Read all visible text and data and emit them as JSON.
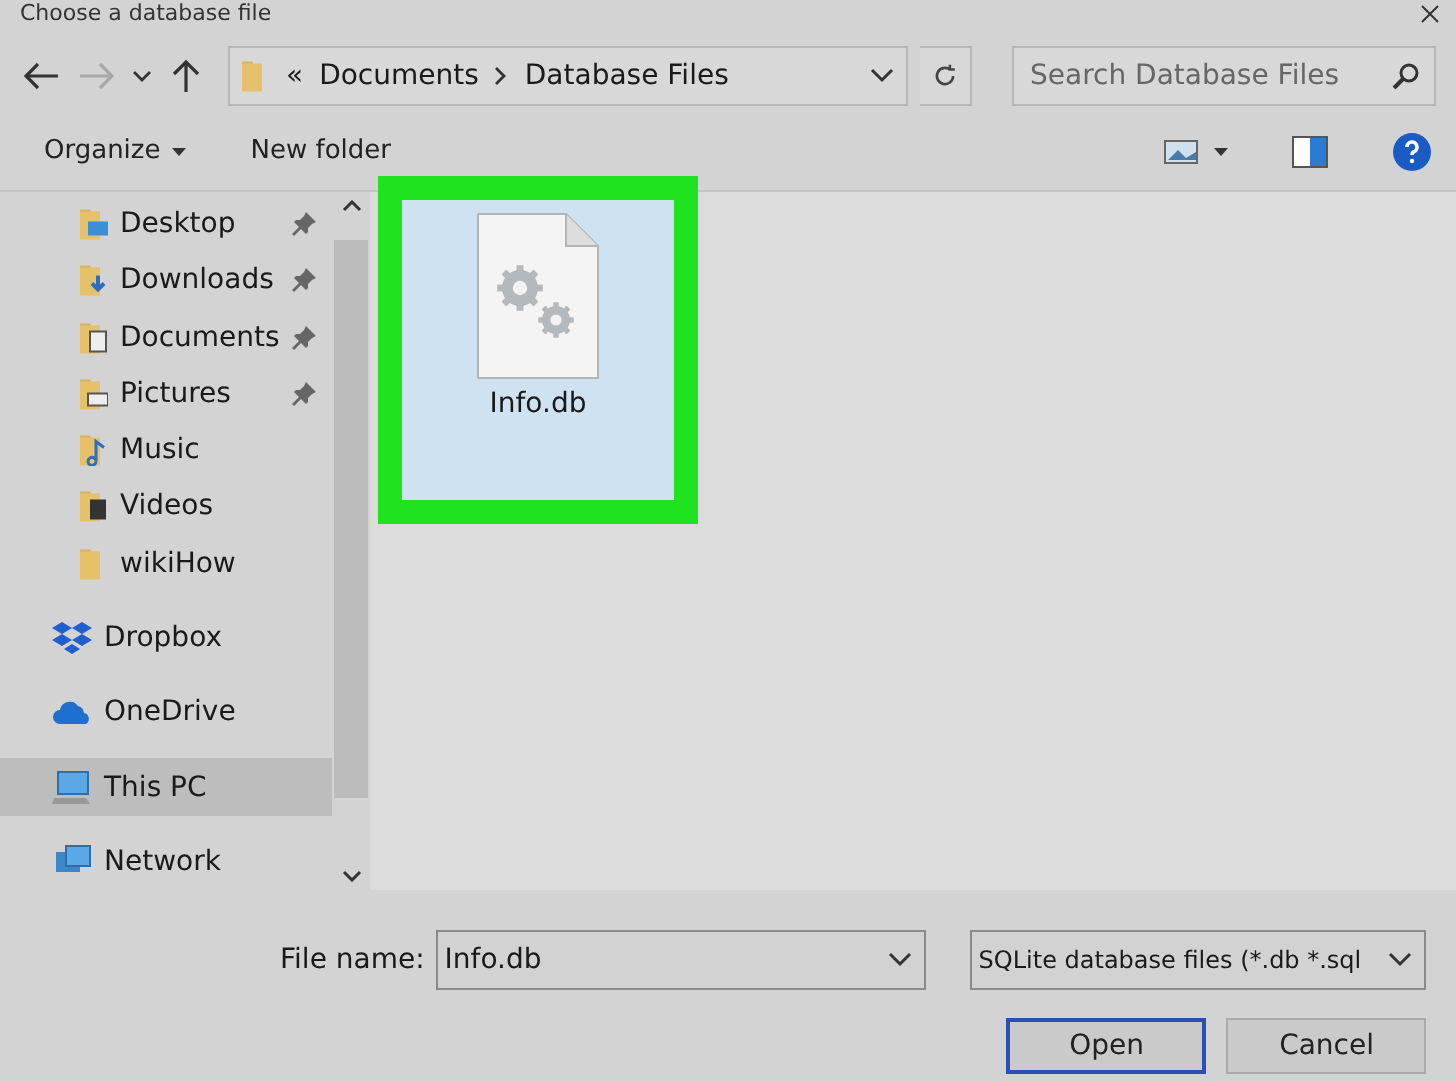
{
  "window": {
    "title": "Choose a database file"
  },
  "address_bar": {
    "overflow": "«",
    "path": [
      "Documents",
      "Database Files"
    ]
  },
  "search": {
    "placeholder": "Search Database Files"
  },
  "toolbar": {
    "organize": "Organize",
    "new_folder": "New folder"
  },
  "sidebar": {
    "items": [
      {
        "label": "Desktop",
        "kind": "desktop",
        "pinned": true,
        "selected": false
      },
      {
        "label": "Downloads",
        "kind": "downloads",
        "pinned": true,
        "selected": false
      },
      {
        "label": "Documents",
        "kind": "documents",
        "pinned": true,
        "selected": false
      },
      {
        "label": "Pictures",
        "kind": "pictures",
        "pinned": true,
        "selected": false
      },
      {
        "label": "Music",
        "kind": "music",
        "pinned": false,
        "selected": false
      },
      {
        "label": "Videos",
        "kind": "videos",
        "pinned": false,
        "selected": false
      },
      {
        "label": "wikiHow",
        "kind": "folder",
        "pinned": false,
        "selected": false
      },
      {
        "label": "Dropbox",
        "kind": "dropbox",
        "pinned": false,
        "selected": false
      },
      {
        "label": "OneDrive",
        "kind": "onedrive",
        "pinned": false,
        "selected": false
      },
      {
        "label": "This PC",
        "kind": "pc",
        "pinned": false,
        "selected": true
      },
      {
        "label": "Network",
        "kind": "network",
        "pinned": false,
        "selected": false
      }
    ]
  },
  "files": [
    {
      "name": "Info.db",
      "selected": true,
      "highlighted": true
    }
  ],
  "file_name": {
    "label": "File name:",
    "value": "Info.db"
  },
  "file_type": "SQLite database files (*.db *.sql",
  "buttons": [
    "Open",
    "Cancel"
  ]
}
